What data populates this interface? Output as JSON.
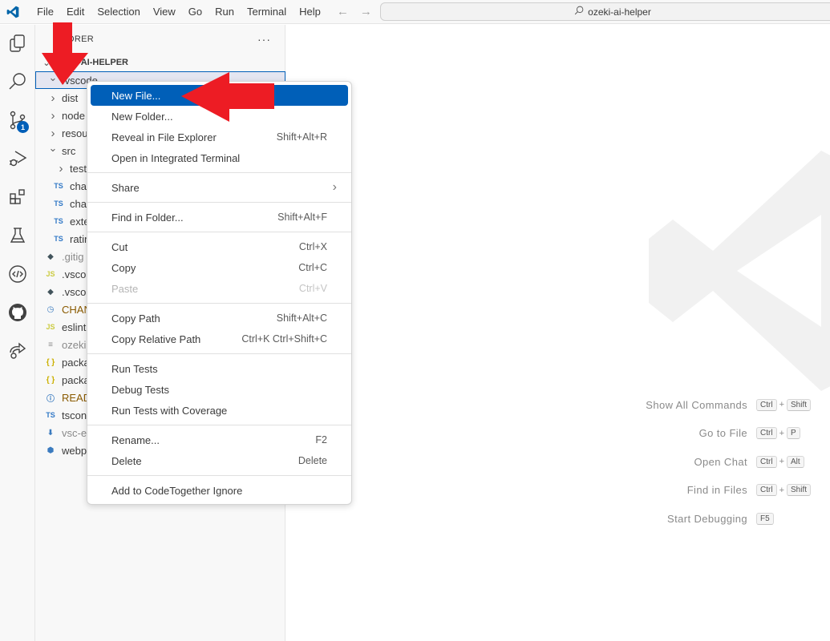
{
  "titlebar": {
    "menu": [
      "File",
      "Edit",
      "Selection",
      "View",
      "Go",
      "Run",
      "Terminal",
      "Help"
    ],
    "nav_back": "←",
    "nav_forward": "→",
    "command_center": "ozeki-ai-helper"
  },
  "activitybar": {
    "items": [
      {
        "name": "explorer",
        "icon": "files-icon",
        "active": true
      },
      {
        "name": "search",
        "icon": "search-icon"
      },
      {
        "name": "source-control",
        "icon": "source-control-icon",
        "badge": "1"
      },
      {
        "name": "run-debug",
        "icon": "run-debug-icon"
      },
      {
        "name": "extensions",
        "icon": "extensions-icon"
      },
      {
        "name": "testing",
        "icon": "beaker-icon"
      },
      {
        "name": "code-together",
        "icon": "code-icon"
      },
      {
        "name": "github",
        "icon": "github-icon"
      },
      {
        "name": "live-share",
        "icon": "live-share-icon"
      }
    ]
  },
  "sidebar": {
    "header": "EXPLORER",
    "header_visible": "ORER",
    "more": "···",
    "folder_title": "OZEKI-AI-HELPER",
    "folder_title_visible": "I-AI-HELPER",
    "tree": [
      {
        "label": ".vscode",
        "type": "folder",
        "expanded": true,
        "depth": 0,
        "selected": true
      },
      {
        "label": "dist",
        "type": "folder",
        "expanded": false,
        "depth": 0
      },
      {
        "label": "node",
        "type": "folder",
        "expanded": false,
        "depth": 0
      },
      {
        "label": "resou",
        "type": "folder",
        "expanded": false,
        "depth": 0
      },
      {
        "label": "src",
        "type": "folder",
        "expanded": true,
        "depth": 0
      },
      {
        "label": "test",
        "type": "folder",
        "expanded": false,
        "depth": 1
      },
      {
        "label": "chat",
        "type": "ts",
        "depth": 1
      },
      {
        "label": "chat",
        "type": "ts",
        "depth": 1
      },
      {
        "label": "exte",
        "type": "ts",
        "depth": 1
      },
      {
        "label": "ratin",
        "type": "ts",
        "depth": 1
      },
      {
        "label": ".gitig",
        "type": "git",
        "depth": 0
      },
      {
        "label": ".vsco",
        "type": "js",
        "depth": 0
      },
      {
        "label": ".vsco",
        "type": "git",
        "depth": 0
      },
      {
        "label": "CHAN",
        "type": "changelog",
        "depth": 0
      },
      {
        "label": "eslint",
        "type": "js",
        "depth": 0
      },
      {
        "label": "ozeki",
        "type": "text",
        "depth": 0
      },
      {
        "label": "packa",
        "type": "json",
        "depth": 0
      },
      {
        "label": "packa",
        "type": "json",
        "depth": 0
      },
      {
        "label": "READ",
        "type": "info",
        "depth": 0
      },
      {
        "label": "tscon",
        "type": "tsconfig",
        "depth": 0
      },
      {
        "label": "vsc-e",
        "type": "vsix",
        "depth": 0
      },
      {
        "label": "webp",
        "type": "webpack",
        "depth": 0
      }
    ]
  },
  "context_menu": {
    "groups": [
      [
        {
          "label": "New File...",
          "key": "",
          "highlight": true
        },
        {
          "label": "New Folder...",
          "key": ""
        },
        {
          "label": "Reveal in File Explorer",
          "key": "Shift+Alt+R"
        },
        {
          "label": "Open in Integrated Terminal",
          "key": ""
        }
      ],
      [
        {
          "label": "Share",
          "key": "",
          "submenu": true
        }
      ],
      [
        {
          "label": "Find in Folder...",
          "key": "Shift+Alt+F"
        }
      ],
      [
        {
          "label": "Cut",
          "key": "Ctrl+X"
        },
        {
          "label": "Copy",
          "key": "Ctrl+C"
        },
        {
          "label": "Paste",
          "key": "Ctrl+V",
          "disabled": true
        }
      ],
      [
        {
          "label": "Copy Path",
          "key": "Shift+Alt+C"
        },
        {
          "label": "Copy Relative Path",
          "key": "Ctrl+K Ctrl+Shift+C"
        }
      ],
      [
        {
          "label": "Run Tests",
          "key": ""
        },
        {
          "label": "Debug Tests",
          "key": ""
        },
        {
          "label": "Run Tests with Coverage",
          "key": ""
        }
      ],
      [
        {
          "label": "Rename...",
          "key": "F2"
        },
        {
          "label": "Delete",
          "key": "Delete"
        }
      ],
      [
        {
          "label": "Add to CodeTogether Ignore",
          "key": ""
        }
      ]
    ],
    "submenu_glyph": "›"
  },
  "editor": {
    "shortcuts": [
      {
        "label": "Show All Commands",
        "keys": [
          "Ctrl",
          "Shift"
        ]
      },
      {
        "label": "Go to File",
        "keys": [
          "Ctrl",
          "P"
        ]
      },
      {
        "label": "Open Chat",
        "keys": [
          "Ctrl",
          "Alt"
        ]
      },
      {
        "label": "Find in Files",
        "keys": [
          "Ctrl",
          "Shift"
        ]
      },
      {
        "label": "Start Debugging",
        "keys": [
          "F5"
        ]
      }
    ]
  },
  "annotations": {
    "arrow_color": "#ed1c24",
    "arrows": [
      {
        "name": "down-arrow-pointing-vscode-folder"
      },
      {
        "name": "left-arrow-pointing-new-file"
      }
    ]
  },
  "colors": {
    "accent": "#005fb8",
    "highlight_text": "#ffffff",
    "arrow": "#ed1c24"
  }
}
